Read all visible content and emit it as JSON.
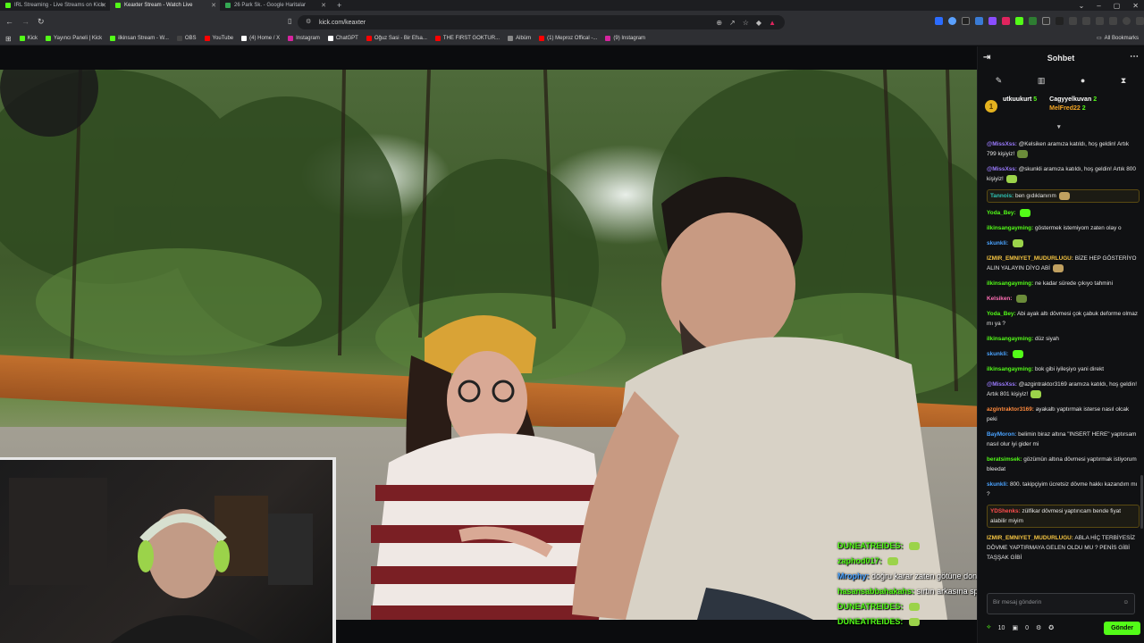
{
  "tabs": [
    {
      "label": "IRL Streaming - Live Streams on Kick",
      "active": false,
      "color": "#53fc18"
    },
    {
      "label": "Keaxter Stream - Watch Live",
      "active": true,
      "color": "#53fc18"
    },
    {
      "label": "26 Park Sk. - Google Haritalar",
      "active": false,
      "color": "#34a853"
    }
  ],
  "address": {
    "url": "kick.com/keaxter"
  },
  "bookmarks": [
    {
      "label": "Kick",
      "color": "#53fc18"
    },
    {
      "label": "Yayıncı Paneli | Kick",
      "color": "#53fc18"
    },
    {
      "label": "ilkinsan Stream - W...",
      "color": "#53fc18"
    },
    {
      "label": "OBS",
      "color": "#444"
    },
    {
      "label": "YouTube",
      "color": "#ff0000"
    },
    {
      "label": "(4) Home / X",
      "color": "#ffffff"
    },
    {
      "label": "Instagram",
      "color": "#d6249f"
    },
    {
      "label": "ChatGPT",
      "color": "#ffffff"
    },
    {
      "label": "Oğuz Sasi - Bir Efsa...",
      "color": "#ff0000"
    },
    {
      "label": "THE FIRST GOKTUR...",
      "color": "#ff0000"
    },
    {
      "label": "Albüm",
      "color": "#888"
    },
    {
      "label": "(1) Meproz Offical -...",
      "color": "#ff0000"
    },
    {
      "label": "(9) Instagram",
      "color": "#d6249f"
    }
  ],
  "all_bookmarks": "All Bookmarks",
  "chat": {
    "title": "Sohbet",
    "leaderboard": [
      {
        "name": "utkuukurt",
        "count": "5",
        "color": "#ffffff"
      },
      {
        "name": "Cagyyelkuvan",
        "count": "2",
        "color": "#ffffff"
      },
      {
        "name": "MelFred22",
        "count": "2",
        "color": "#f5a623"
      }
    ],
    "messages": [
      {
        "user": "@MissXss:",
        "ucolor": "#9b7bff",
        "text": "@Kelsiken aramıza katıldı, hoş geldin! Artık 799 kişiyiz!",
        "hl": false
      },
      {
        "user": "@MissXss:",
        "ucolor": "#9b7bff",
        "text": "@skunkli aramıza katıldı, hoş geldin! Artık 800 kişiyiz!",
        "hl": false
      },
      {
        "user": "Tannois:",
        "ucolor": "#2ec4b6",
        "text": "ben gıdıklanırım",
        "hl": true
      },
      {
        "user": "Yoda_Bey:",
        "ucolor": "#53fc18",
        "text": "",
        "hl": false
      },
      {
        "user": "ilkinsangayming:",
        "ucolor": "#53fc18",
        "text": "göstermek istemiyom zaten olay o",
        "hl": false
      },
      {
        "user": "skunkli:",
        "ucolor": "#4aa3ff",
        "text": "",
        "hl": false
      },
      {
        "user": "IZMIR_EMNIYET_MUDURLUGU:",
        "ucolor": "#f5c542",
        "text": "BİZE HEP GÖSTERİYO ALIN YALAYIN DİYO ABİ",
        "hl": false
      },
      {
        "user": "ilkinsangayming:",
        "ucolor": "#53fc18",
        "text": "ne kadar sürede çıkıyo tahmini",
        "hl": false
      },
      {
        "user": "Kelsiken:",
        "ucolor": "#ff6fb5",
        "text": "",
        "hl": false
      },
      {
        "user": "Yoda_Bey:",
        "ucolor": "#53fc18",
        "text": "Abi ayak altı dövmesi çok çabuk deforme olmaz mı ya ?",
        "hl": false
      },
      {
        "user": "ilkinsangayming:",
        "ucolor": "#53fc18",
        "text": "düz siyah",
        "hl": false
      },
      {
        "user": "skunkli:",
        "ucolor": "#4aa3ff",
        "text": "",
        "hl": false
      },
      {
        "user": "ilkinsangayming:",
        "ucolor": "#53fc18",
        "text": "bok gibi iyileşiyo yani direkt",
        "hl": false
      },
      {
        "user": "@MissXss:",
        "ucolor": "#9b7bff",
        "text": "@azgintraktor3169 aramıza katıldı, hoş geldin! Artık 801 kişiyiz!",
        "hl": false
      },
      {
        "user": "azgintraktor3169:",
        "ucolor": "#ff8a3d",
        "text": "ayakaltı yaptırmak isterse nasıl olcak peki",
        "hl": false
      },
      {
        "user": "BayMoron:",
        "ucolor": "#4aa3ff",
        "text": "belimin biraz altına \"INSERT HERE\" yaptırsam nasıl olur iyi gider mi",
        "hl": false
      },
      {
        "user": "beratsimsek:",
        "ucolor": "#53fc18",
        "text": "gözümün altına dövmesi yaptırmak istiyorum bleedat",
        "hl": false
      },
      {
        "user": "skunkli:",
        "ucolor": "#4aa3ff",
        "text": "800. takipçiyim ücretsiz dövme hakkı kazandım mı ?",
        "hl": false
      },
      {
        "user": "YDShenks:",
        "ucolor": "#ff4d4d",
        "text": "zülfikar dövmesi yaptırıcam bende fiyat alabilir miyim",
        "hl": true
      },
      {
        "user": "IZMIR_EMNIYET_MUDURLUGU:",
        "ucolor": "#f5c542",
        "text": "ABLA HİÇ TERBİYESİZ DÖVME YAPTIRMAYA GELEN OLDU MU ? PENİS GİBİ TAŞŞAK GİBİ",
        "hl": false
      }
    ],
    "input_placeholder": "Bir mesaj gönderin",
    "footer": {
      "points": "10",
      "count": "0",
      "send": "Gönder"
    }
  },
  "overlay_chat": [
    {
      "user": "DUNEATREIDES:",
      "text": "",
      "color": "#53fc18"
    },
    {
      "user": "zaphod017:",
      "text": "",
      "color": "#53fc18"
    },
    {
      "user": "Mrophy:",
      "text": "doğru karar zaten götüne don alcak para yok yaptırma boşa",
      "color": "#4aa3ff"
    },
    {
      "user": "hasansabbahakahs:",
      "text": "sırtın arkasına spiderman kostümündeki gibi logoyu koy",
      "color": "#53fc18"
    },
    {
      "user": "DUNEATREIDES:",
      "text": "",
      "color": "#53fc18"
    },
    {
      "user": "DUNEATREIDES:",
      "text": "",
      "color": "#53fc18"
    }
  ]
}
